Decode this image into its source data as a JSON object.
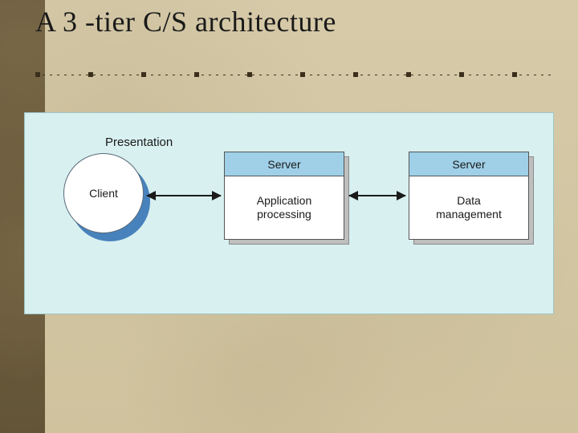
{
  "title": "A 3 -tier C/S architecture",
  "diagram": {
    "presentation_label": "Presentation",
    "client_label": "Client",
    "server1": {
      "header": "Server",
      "body": "Application\nprocessing"
    },
    "server2": {
      "header": "Server",
      "body": "Data\nmanagement"
    }
  }
}
